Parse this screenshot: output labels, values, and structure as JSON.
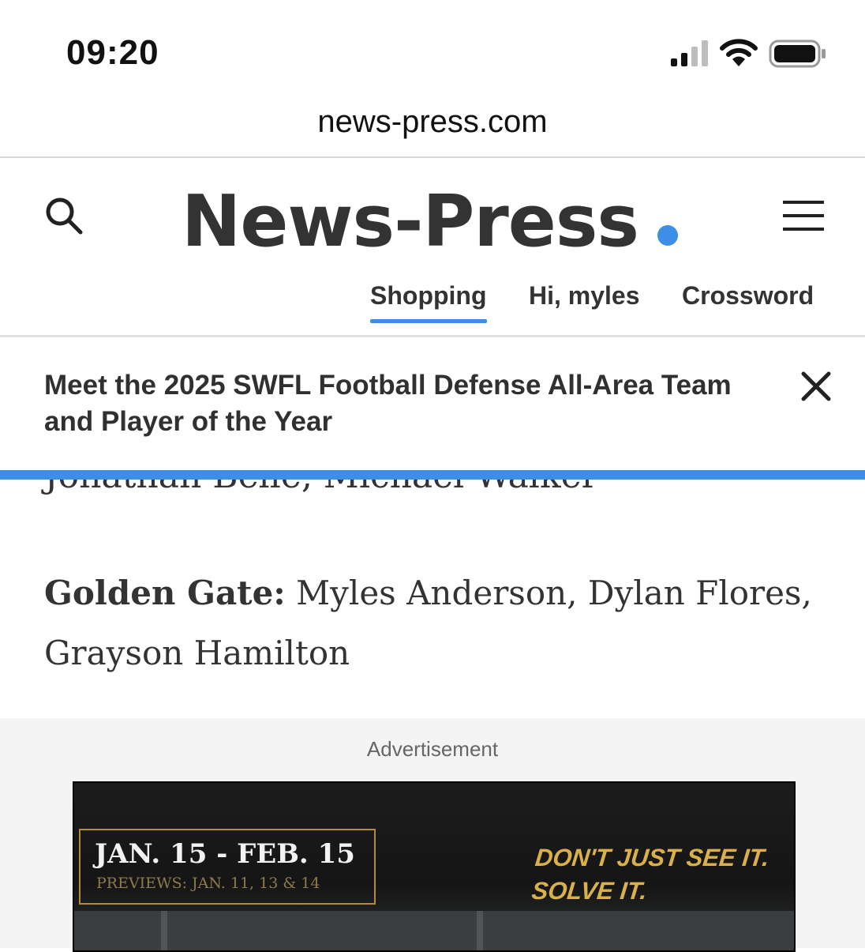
{
  "status_bar": {
    "time": "09:20",
    "icons": [
      "cellular-signal-icon",
      "wifi-icon",
      "battery-icon"
    ]
  },
  "browser": {
    "url": "news-press.com"
  },
  "header": {
    "logo_text": "News-Press",
    "logo_dot_color": "#3d8ee6",
    "nav": [
      {
        "label": "Shopping",
        "active": true
      },
      {
        "label": "Hi, myles",
        "active": false
      },
      {
        "label": "Crossword",
        "active": false
      }
    ]
  },
  "banner": {
    "headline": "Meet the 2025 SWFL Football Defense All-Area Team and Player of the Year",
    "progress_color": "#3d8ee6"
  },
  "article": {
    "partial_line": "Jonathan Belle, Michael Walker",
    "team": "Golden Gate:",
    "players": " Myles Anderson, Dylan Flores, Grayson Hamilton"
  },
  "advertisement": {
    "label": "Advertisement",
    "dates": "JAN. 15 - FEB. 15",
    "previews": "PREVIEWS: JAN. 11, 13 & 14",
    "tagline_line1": "DON'T JUST SEE IT.",
    "tagline_line2": "SOLVE IT."
  }
}
